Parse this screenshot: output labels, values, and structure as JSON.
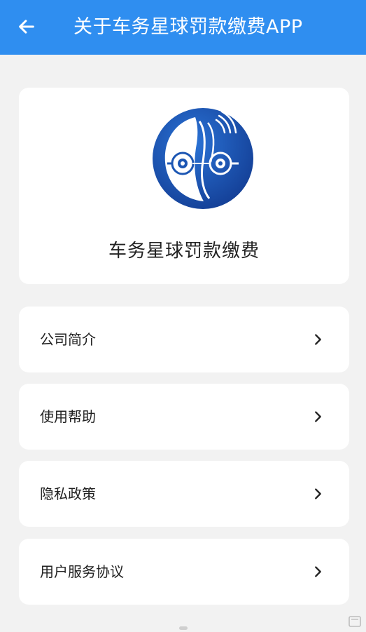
{
  "header": {
    "title": "关于车务星球罚款缴费APP"
  },
  "app": {
    "name": "车务星球罚款缴费",
    "brand_color": "#1c56b3"
  },
  "menu": {
    "items": [
      {
        "label": "公司简介"
      },
      {
        "label": "使用帮助"
      },
      {
        "label": "隐私政策"
      },
      {
        "label": "用户服务协议"
      }
    ]
  },
  "colors": {
    "header_bg": "#2f8ef0",
    "page_bg": "#f2f2f2",
    "card_bg": "#ffffff"
  },
  "icons": {
    "back": "arrow-left-icon",
    "item_arrow": "chevron-right-icon"
  }
}
